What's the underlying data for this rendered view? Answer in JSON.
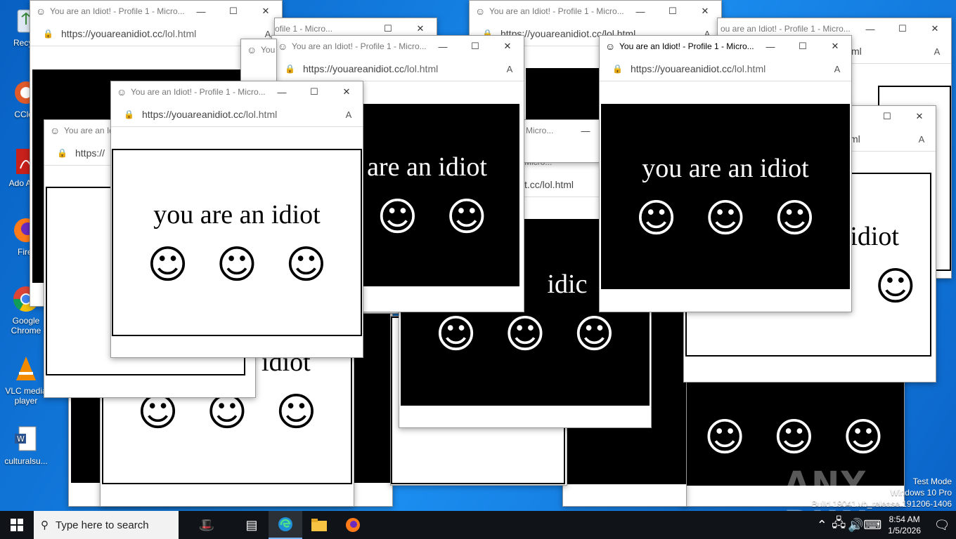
{
  "desktop": {
    "icons": [
      {
        "label": "Recycl",
        "name": "recycle-bin-icon"
      },
      {
        "label": "CClea",
        "name": "ccleaner-icon"
      },
      {
        "label": "Ado Acro",
        "name": "adobe-acrobat-icon"
      },
      {
        "label": "Firef",
        "name": "firefox-icon"
      },
      {
        "label": "Google Chrome",
        "name": "chrome-icon"
      },
      {
        "label": "VLC media player",
        "name": "vlc-icon"
      },
      {
        "label": "culturalsu...",
        "name": "word-document-icon"
      }
    ]
  },
  "popup": {
    "title_full": "You are an Idiot! - Profile 1 - Micro...",
    "title_short": "You are an Id",
    "title_tiny": "You",
    "title_frag": "ofile 1 - Micro...",
    "title_frag2": "ou are an Idiot! - Profile 1 - Micro...",
    "title_micro": "Micro...",
    "url": "https://youareanidiot.cc/lol.html",
    "url_host": "https://youareanidiot.cc",
    "url_path": "/lol.html",
    "url_short": "https://",
    "url_frag": "t.cc/lol.html",
    "url_frag2": "ml",
    "message": "you are an idiot",
    "message_frag": "are an idiot",
    "message_frag2": "idiot",
    "message_frag3": "idic",
    "face": "☺"
  },
  "taskbar": {
    "search_placeholder": "Type here to search",
    "time": "8:54 AM",
    "date": "1/5/2026"
  },
  "watermark": {
    "line1": "Test Mode",
    "line2": "Windows 10 Pro",
    "line3": "Build 19041.vb_release.191206-1406",
    "brand": "ANY RUN"
  }
}
